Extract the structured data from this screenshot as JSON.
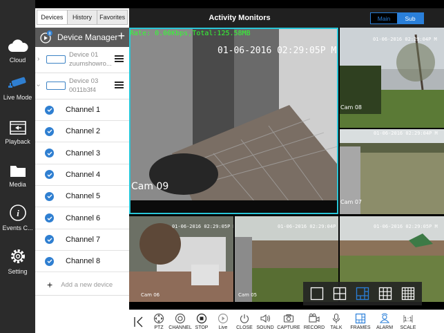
{
  "rail": {
    "items": [
      {
        "label": "Cloud",
        "icon": "cloud-icon"
      },
      {
        "label": "Live Mode",
        "icon": "camera-icon"
      },
      {
        "label": "Playback",
        "icon": "playback-icon"
      },
      {
        "label": "Media",
        "icon": "folder-icon"
      },
      {
        "label": "Events C...",
        "icon": "info-icon"
      },
      {
        "label": "Setting",
        "icon": "gear-icon"
      }
    ]
  },
  "panel": {
    "tabs": [
      "Devices",
      "History",
      "Favorites"
    ],
    "active_tab": "Devices",
    "header_title": "Device Manager",
    "header_badge": "8",
    "devices": [
      {
        "name": "Device 01",
        "detail": "zuumshowro..."
      },
      {
        "name": "Device 03",
        "detail": "0011b3f4"
      }
    ],
    "channels": [
      "Channel 1",
      "Channel 2",
      "Channel 3",
      "Channel 4",
      "Channel 5",
      "Channel 6",
      "Channel 7",
      "Channel 8"
    ],
    "add_device": "Add a new device"
  },
  "topbar": {
    "title": "Activity Monitors",
    "stream_main": "Main",
    "stream_sub": "Sub",
    "selected_stream": "Main"
  },
  "video": {
    "rate": "Rate: 0.00Kbps,Total:125.58MB",
    "cams": [
      {
        "label": "Cam 09",
        "timestamp": "01-06-2016 02:29:05P M"
      },
      {
        "label": "Cam 08",
        "timestamp": "01-06-2016 02:29:04P M"
      },
      {
        "label": "Cam 07",
        "timestamp": "01-06-2016 02:29:04P M"
      },
      {
        "label": "Cam 06",
        "timestamp": "01-06-2016 02:29:05P M"
      },
      {
        "label": "Cam 05",
        "timestamp": "01-06-2016 02:29:04P M"
      },
      {
        "label": "",
        "timestamp": "01-06-2016 02:29:05P M"
      }
    ]
  },
  "frames": {
    "options": [
      "1x1",
      "2x2",
      "1+5",
      "3x3",
      "4x4"
    ],
    "selected": "1+5"
  },
  "toolbar": {
    "items": [
      {
        "label": "",
        "icon": "collapse-icon"
      },
      {
        "label": "PTZ",
        "icon": "ptz-icon"
      },
      {
        "label": "CHANNEL",
        "icon": "channel-icon"
      },
      {
        "label": "STOP",
        "icon": "stop-icon"
      },
      {
        "label": "Live",
        "icon": "live-icon"
      },
      {
        "label": "CLOSE",
        "icon": "power-icon"
      },
      {
        "label": "SOUND",
        "icon": "sound-icon"
      },
      {
        "label": "CAPTURE",
        "icon": "capture-icon"
      },
      {
        "label": "RECORD",
        "icon": "record-icon"
      },
      {
        "label": "TALK",
        "icon": "mic-icon"
      },
      {
        "label": "FRAMES",
        "icon": "frames-icon"
      },
      {
        "label": "ALARM",
        "icon": "alarm-icon"
      },
      {
        "label": "SCALE",
        "icon": "scale-icon"
      }
    ]
  },
  "colors": {
    "accent": "#2a7fd9",
    "selected_frame": "#29c6d8",
    "rate_text": "#32ff32"
  }
}
